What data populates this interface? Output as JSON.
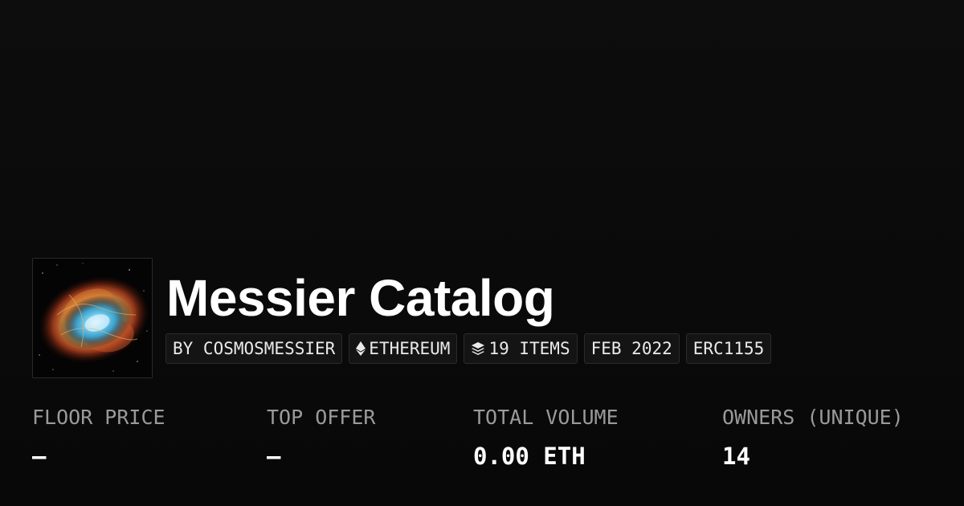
{
  "collection": {
    "title": "Messier Catalog",
    "thumbnail_icon": "crab-nebula-image"
  },
  "pills": {
    "creator": "BY COSMOSMESSIER",
    "chain": "ETHEREUM",
    "chain_icon": "ethereum-icon",
    "items": "19 ITEMS",
    "items_icon": "layers-icon",
    "date": "FEB 2022",
    "standard": "ERC1155"
  },
  "stats": {
    "floor_price": {
      "label": "FLOOR PRICE",
      "value": "–"
    },
    "top_offer": {
      "label": "TOP OFFER",
      "value": "–"
    },
    "total_volume": {
      "label": "TOTAL VOLUME",
      "value": "0.00 ETH"
    },
    "owners": {
      "label": "OWNERS (UNIQUE)",
      "value": "14"
    }
  },
  "colors": {
    "background": "#0c0c0c",
    "text": "#ffffff",
    "muted": "#9a9a9a",
    "pill_bg": "#141414",
    "pill_border": "#2b2b2b"
  }
}
